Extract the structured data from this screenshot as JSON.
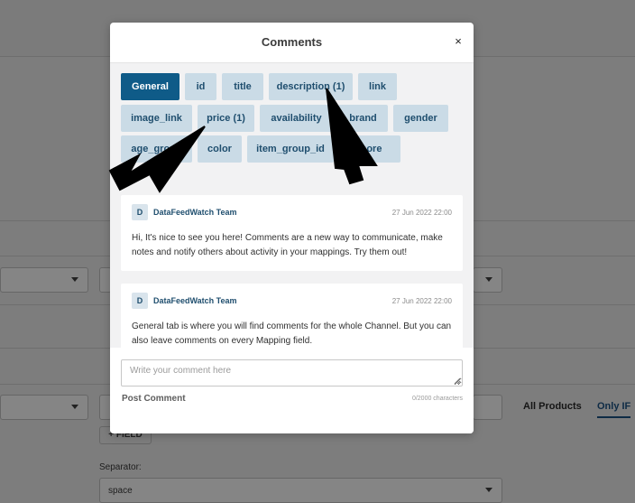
{
  "background": {
    "field_button_label": "+ FIELD",
    "separator_label": "Separator:",
    "separator_value": "space",
    "tabs": [
      "All Products",
      "Only IF"
    ]
  },
  "modal": {
    "title": "Comments",
    "close_icon": "close-icon",
    "close_glyph": "×",
    "tabs": [
      {
        "label": "General",
        "active": true
      },
      {
        "label": "id"
      },
      {
        "label": "title"
      },
      {
        "label": "description (1)"
      },
      {
        "label": "link"
      },
      {
        "label": "image_link"
      },
      {
        "label": "price (1)"
      },
      {
        "label": "availability"
      },
      {
        "label": "brand"
      },
      {
        "label": "gender"
      },
      {
        "label": "age_group"
      },
      {
        "label": "color"
      },
      {
        "label": "item_group_id"
      },
      {
        "label": "more"
      }
    ],
    "comments": [
      {
        "avatar_initial": "D",
        "author": "DataFeedWatch Team",
        "timestamp": "27 Jun 2022 22:00",
        "text": "Hi, It's nice to see you here! Comments are a new way to communicate, make notes and notify others about activity in your mappings. Try them out!"
      },
      {
        "avatar_initial": "D",
        "author": "DataFeedWatch Team",
        "timestamp": "27 Jun 2022 22:00",
        "text": "General tab is where you will find comments for the whole Channel. But you can also leave comments on every Mapping field."
      }
    ],
    "input_placeholder": "Write your comment here",
    "post_button": "Post Comment",
    "char_count": "0/2000 characters"
  },
  "colors": {
    "active_tab": "#0f5b88",
    "tab_bg": "#cadbe6",
    "tab_text": "#1f4e6e",
    "overlay": "#7d7d7d"
  }
}
